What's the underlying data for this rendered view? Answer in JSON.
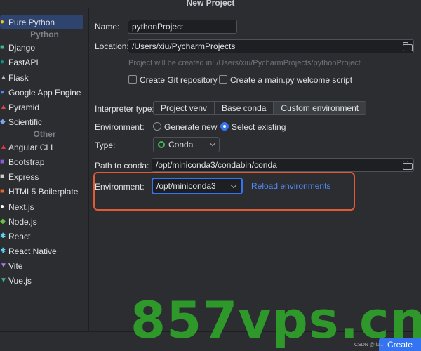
{
  "window": {
    "title": "New Project"
  },
  "sidebar": {
    "selected": {
      "label": "Pure Python",
      "icon": "python-icon"
    },
    "python_header": "Python",
    "python_items": [
      {
        "label": "Django",
        "icon": "django-icon"
      },
      {
        "label": "FastAPI",
        "icon": "fastapi-icon"
      },
      {
        "label": "Flask",
        "icon": "flask-icon"
      },
      {
        "label": "Google App Engine",
        "icon": "google-app-engine-icon"
      },
      {
        "label": "Pyramid",
        "icon": "pyramid-icon"
      },
      {
        "label": "Scientific",
        "icon": "scientific-icon"
      }
    ],
    "other_header": "Other",
    "other_items": [
      {
        "label": "Angular CLI",
        "icon": "angular-icon"
      },
      {
        "label": "Bootstrap",
        "icon": "bootstrap-icon"
      },
      {
        "label": "Express",
        "icon": "express-icon"
      },
      {
        "label": "HTML5 Boilerplate",
        "icon": "html5-icon"
      },
      {
        "label": "Next.js",
        "icon": "nextjs-icon"
      },
      {
        "label": "Node.js",
        "icon": "nodejs-icon"
      },
      {
        "label": "React",
        "icon": "react-icon"
      },
      {
        "label": "React Native",
        "icon": "react-native-icon"
      },
      {
        "label": "Vite",
        "icon": "vite-icon"
      },
      {
        "label": "Vue.js",
        "icon": "vuejs-icon"
      }
    ]
  },
  "form": {
    "name_label": "Name:",
    "name_value": "pythonProject",
    "location_label": "Location:",
    "location_value": "/Users/xiu/PycharmProjects",
    "location_hint": "Project will be created in: /Users/xiu/PycharmProjects/pythonProject",
    "git_checkbox_label": "Create Git repository",
    "git_checked": false,
    "welcome_checkbox_label": "Create a main.py welcome script",
    "welcome_checked": false,
    "interpreter_label": "Interpreter type:",
    "interpreter_options": [
      "Project venv",
      "Base conda",
      "Custom environment"
    ],
    "interpreter_selected": "Custom environment",
    "environment_label": "Environment:",
    "env_radio_generate": "Generate new",
    "env_radio_existing": "Select existing",
    "env_radio_selected": "Select existing",
    "type_label": "Type:",
    "type_value": "Conda",
    "path_label": "Path to conda:",
    "path_value": "/opt/miniconda3/condabin/conda",
    "env2_label": "Environment:",
    "env2_value": "/opt/miniconda3",
    "reload_link": "Reload environments"
  },
  "footer": {
    "create_label": "Create"
  },
  "overlay": {
    "watermark_text": "857vps.cn",
    "csdn_text": "CSDN @liu..."
  },
  "colors": {
    "accent": "#3574f0",
    "selection": "#2e436e",
    "highlight_box": "#e05a34",
    "watermark": "#2f9e2a",
    "conda_green": "#3fb950"
  }
}
